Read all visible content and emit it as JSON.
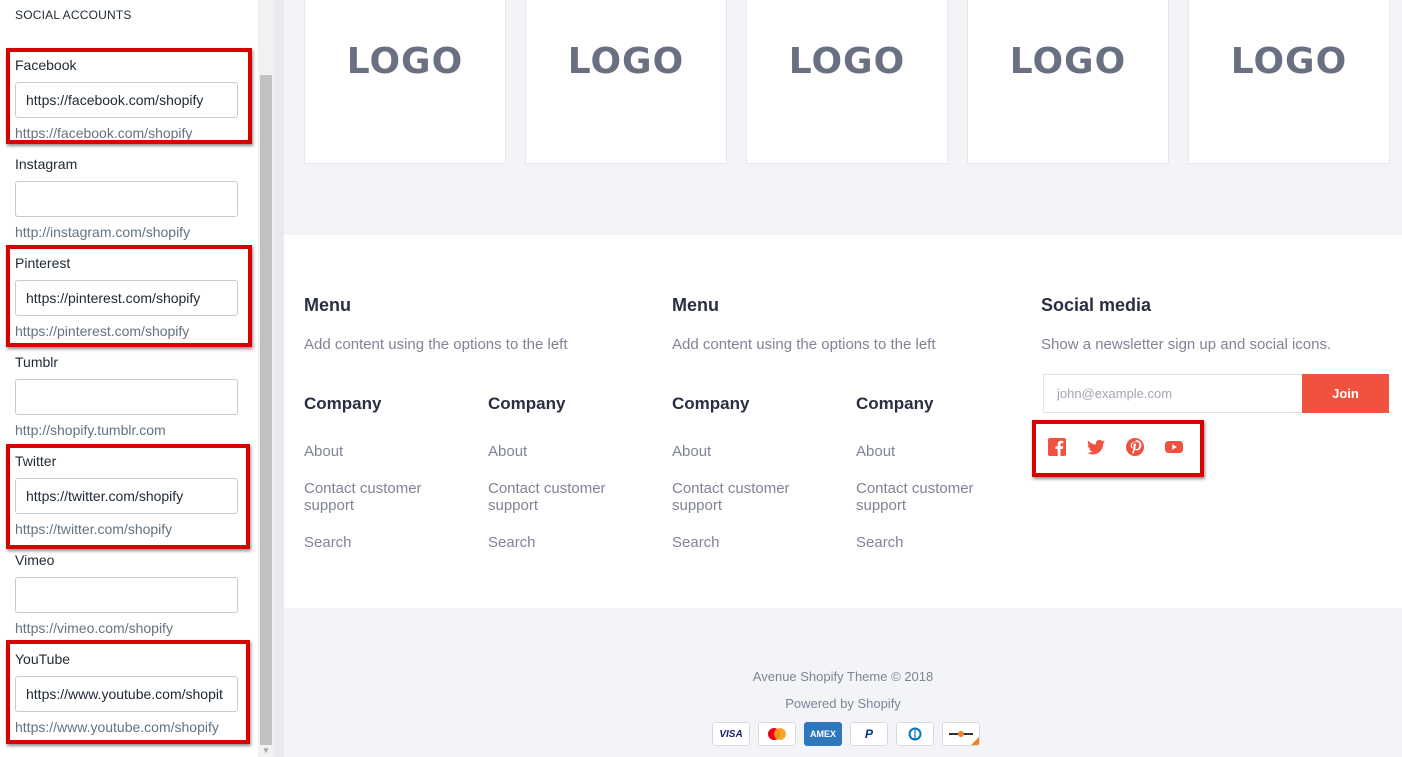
{
  "sidebar": {
    "heading": "SOCIAL ACCOUNTS",
    "fields": [
      {
        "label": "Facebook",
        "value": "https://facebook.com/shopify",
        "placeholder": "",
        "help": "https://facebook.com/shopify",
        "highlighted": true
      },
      {
        "label": "Instagram",
        "value": "",
        "placeholder": "",
        "help": "http://instagram.com/shopify",
        "highlighted": false
      },
      {
        "label": "Pinterest",
        "value": "https://pinterest.com/shopify",
        "placeholder": "",
        "help": "https://pinterest.com/shopify",
        "highlighted": true
      },
      {
        "label": "Tumblr",
        "value": "",
        "placeholder": "",
        "help": "http://shopify.tumblr.com",
        "highlighted": false
      },
      {
        "label": "Twitter",
        "value": "https://twitter.com/shopify",
        "placeholder": "",
        "help": "https://twitter.com/shopify",
        "highlighted": true
      },
      {
        "label": "Vimeo",
        "value": "",
        "placeholder": "",
        "help": "https://vimeo.com/shopify",
        "highlighted": false
      },
      {
        "label": "YouTube",
        "value": "https://www.youtube.com/shopit",
        "placeholder": "",
        "help": "https://www.youtube.com/shopify",
        "highlighted": true
      }
    ]
  },
  "preview": {
    "logos": [
      "LOGO",
      "LOGO",
      "LOGO",
      "LOGO",
      "LOGO"
    ],
    "footer": {
      "menu1": {
        "title": "Menu",
        "text": "Add content using the options to the left"
      },
      "menu2": {
        "title": "Menu",
        "text": "Add content using the options to the left"
      },
      "social": {
        "title": "Social media",
        "text": "Show a newsletter sign up and social icons."
      },
      "companies": [
        {
          "title": "Company",
          "links": [
            "About",
            "Contact customer support",
            "Search"
          ]
        },
        {
          "title": "Company",
          "links": [
            "About",
            "Contact customer support",
            "Search"
          ]
        },
        {
          "title": "Company",
          "links": [
            "About",
            "Contact customer support",
            "Search"
          ]
        },
        {
          "title": "Company",
          "links": [
            "About",
            "Contact customer support",
            "Search"
          ]
        }
      ],
      "newsletter": {
        "placeholder": "john@example.com",
        "button": "Join"
      },
      "social_icons": [
        "facebook-icon",
        "twitter-icon",
        "pinterest-icon",
        "youtube-icon"
      ]
    },
    "bottom": {
      "copyright": "Avenue Shopify Theme © 2018",
      "powered": "Powered by Shopify",
      "payments": [
        "visa",
        "mastercard",
        "amex",
        "paypal",
        "diners",
        "discover"
      ],
      "payment_labels": {
        "visa": "VISA",
        "amex": "AMEX",
        "paypal": "P"
      }
    }
  },
  "colors": {
    "accent": "#f0523f",
    "highlight_box": "#d90000",
    "preview_bg": "#f3f4f8",
    "heading_text": "#2b2d42",
    "muted_text": "#808494"
  }
}
